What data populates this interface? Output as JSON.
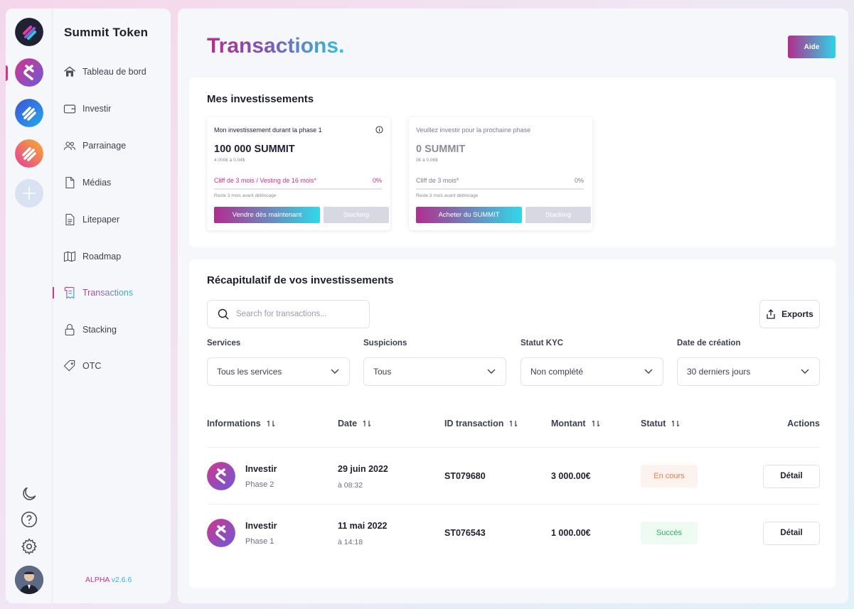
{
  "app": {
    "brand": "Summit Token",
    "version_prefix": "ALPHA",
    "version_number": "v2.6.6"
  },
  "nav": [
    {
      "label": "Tableau de bord",
      "icon": "home-icon"
    },
    {
      "label": "Investir",
      "icon": "wallet-icon"
    },
    {
      "label": "Parrainage",
      "icon": "users-icon"
    },
    {
      "label": "Médias",
      "icon": "document-icon"
    },
    {
      "label": "Litepaper",
      "icon": "file-text-icon"
    },
    {
      "label": "Roadmap",
      "icon": "map-icon"
    },
    {
      "label": "Transactions",
      "icon": "receipt-icon",
      "active": true
    },
    {
      "label": "Stacking",
      "icon": "lock-icon"
    },
    {
      "label": "OTC",
      "icon": "tag-icon"
    }
  ],
  "header": {
    "title": "Transactions.",
    "help_label": "Aide"
  },
  "investments": {
    "title": "Mes investissements",
    "cards": [
      {
        "header": "Mon investissement durant la phase 1",
        "amount": "100 000 SUMMIT",
        "sub": "4 000€ à 0,04$",
        "cliff": "Cliff de 3 mois / Vesting de 16 mois*",
        "percent": "0%",
        "progress": 0,
        "remaining": "Reste 3 mois avant déblocage",
        "primary_label": "Vendre dès maintenant",
        "stacking_label": "Stacking"
      },
      {
        "header": "Veuillez investir pour la prochaine phase",
        "amount": "0 SUMMIT",
        "sub": "0€ à 0,06$",
        "cliff": "Cliff de 3 mois*",
        "percent": "0%",
        "progress": 0,
        "remaining": "Reste 3 mois avant déblocage",
        "primary_label": "Acheter du SUMMIT",
        "stacking_label": "Stacking"
      }
    ]
  },
  "summary": {
    "title": "Récapitulatif de vos investissements",
    "search_placeholder": "Search for transactions...",
    "exports_label": "Exports",
    "filters": [
      {
        "label": "Services",
        "value": "Tous les services"
      },
      {
        "label": "Suspicions",
        "value": "Tous"
      },
      {
        "label": "Statut KYC",
        "value": "Non complété"
      },
      {
        "label": "Date de création",
        "value": "30 derniers jours"
      }
    ],
    "columns": [
      "Informations",
      "Date",
      "ID transaction",
      "Montant",
      "Statut",
      "Actions"
    ],
    "rows": [
      {
        "name": "Investir",
        "phase": "Phase 2",
        "date": "29 juin 2022",
        "time": "à 08:32",
        "id": "ST079680",
        "amount": "3 000.00€",
        "status": "En cours",
        "detail": "Détail"
      },
      {
        "name": "Investir",
        "phase": "Phase 1",
        "date": "11 mai 2022",
        "time": "à 14:18",
        "id": "ST076543",
        "amount": "1 000.00€",
        "status": "Succès",
        "detail": "Détail"
      }
    ]
  },
  "colors": {
    "accent_pink": "#c2338f",
    "accent_cyan": "#2fd3e6",
    "pending": "#ef7a4a",
    "success": "#27b463"
  }
}
